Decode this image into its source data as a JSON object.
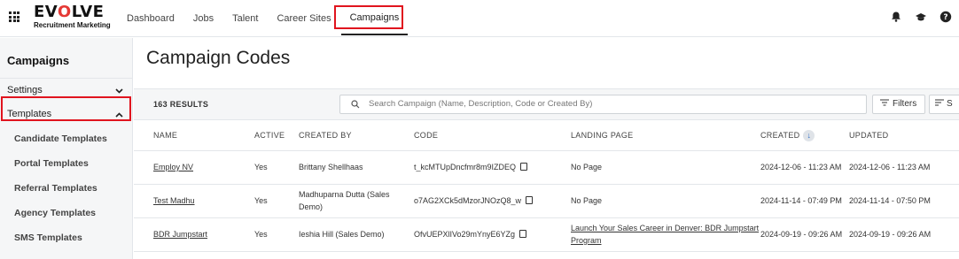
{
  "brand": {
    "name_prefix": "EV",
    "name_o": "O",
    "name_suffix": "LVE",
    "subtitle": "Recruitment Marketing",
    "accent": "#e53935"
  },
  "nav": {
    "items": [
      {
        "label": "Dashboard"
      },
      {
        "label": "Jobs"
      },
      {
        "label": "Talent"
      },
      {
        "label": "Career Sites"
      },
      {
        "label": "Campaigns"
      }
    ],
    "active": "Campaigns"
  },
  "top_icons": [
    "bell-icon",
    "graduation-cap-icon",
    "help-icon"
  ],
  "sidebar": {
    "title": "Campaigns",
    "sections": [
      {
        "label": "Settings",
        "chevron": "chevron-down-icon"
      },
      {
        "label": "Templates",
        "chevron": "chevron-up-icon"
      }
    ],
    "template_items": [
      {
        "label": "Candidate Templates"
      },
      {
        "label": "Portal Templates"
      },
      {
        "label": "Referral Templates"
      },
      {
        "label": "Agency Templates"
      },
      {
        "label": "SMS Templates"
      }
    ]
  },
  "page": {
    "title": "Campaign Codes"
  },
  "results": {
    "count_label": "163 RESULTS",
    "search_placeholder": "Search Campaign (Name, Description, Code or Created By)",
    "filters_label": "Filters",
    "sort_label": "S"
  },
  "table": {
    "headers": {
      "name": "NAME",
      "active": "ACTIVE",
      "created_by": "CREATED BY",
      "code": "CODE",
      "landing_page": "LANDING PAGE",
      "created": "CREATED",
      "updated": "UPDATED"
    },
    "rows": [
      {
        "name": "Employ NV",
        "active": "Yes",
        "created_by": "Brittany Shellhaas",
        "code": "t_kcMTUpDncfmr8m9IZDEQ",
        "landing_page": "No Page",
        "created": "2024-12-06 - 11:23 AM",
        "updated": "2024-12-06 - 11:23 AM"
      },
      {
        "name": "Test Madhu",
        "active": "Yes",
        "created_by": "Madhuparna Dutta (Sales Demo)",
        "code": "o7AG2XCk5dMzorJNOzQ8_w",
        "landing_page": "No Page",
        "created": "2024-11-14 - 07:49 PM",
        "updated": "2024-11-14 - 07:50 PM"
      },
      {
        "name": "BDR Jumpstart",
        "active": "Yes",
        "created_by": "Ieshia Hill (Sales Demo)",
        "code": "OfvUEPXlIVo29mYnyE6YZg",
        "landing_page": "Launch Your Sales Career in Denver: BDR Jumpstart Program",
        "created": "2024-09-19 - 09:26 AM",
        "updated": "2024-09-19 - 09:26 AM"
      }
    ]
  },
  "colors": {
    "highlight": "#e0141e",
    "link": "#2f6fc6",
    "sidebar_bg": "#f5f6f7"
  }
}
